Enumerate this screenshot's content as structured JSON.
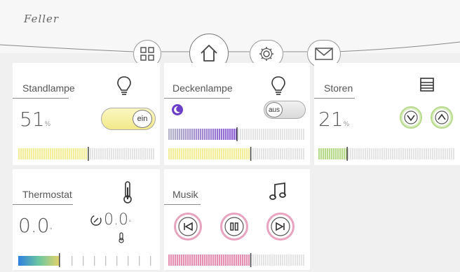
{
  "app": {
    "brand": "Feller",
    "nav": [
      {
        "icon": "grid-icon",
        "label": ""
      },
      {
        "icon": "home-icon",
        "label": ""
      },
      {
        "icon": "gear-icon",
        "label": ""
      },
      {
        "icon": "mail-icon",
        "label": ""
      }
    ]
  },
  "cards": {
    "standlampe": {
      "title": "Standlampe",
      "value": "51",
      "unit": "%",
      "toggle_label": "ein",
      "toggle_state": "on",
      "level": 0.51,
      "icon": "lightbulb-icon"
    },
    "deckenlampe": {
      "title": "Deckenlampe",
      "toggle_label": "aus",
      "toggle_state": "off",
      "mode_icon": "moon-icon",
      "color_level": 0.5,
      "level": 0.6,
      "icon": "lightbulb-icon"
    },
    "storen": {
      "title": "Storen",
      "value": "21",
      "unit": "%",
      "level": 0.21,
      "icon": "blinds-icon",
      "down_icon": "chevron-down-icon",
      "up_icon": "chevron-up-icon"
    },
    "thermostat": {
      "title": "Thermostat",
      "value": "0.0",
      "unit": "°",
      "setpoint": "0.0",
      "setpoint_unit": "°",
      "icon": "thermometer-icon",
      "setpoint_icon": "rotate-icon",
      "level": 0.3
    },
    "musik": {
      "title": "Musik",
      "icon": "music-note-icon",
      "prev_icon": "previous-icon",
      "pause_icon": "pause-icon",
      "next_icon": "next-icon",
      "level": 0.6
    }
  },
  "colors": {
    "accent_yellow": "#f4ee9a",
    "accent_pink": "#e58fb0",
    "accent_green": "#b6d98a",
    "accent_purple": "#8a5bd6",
    "line": "#888888"
  }
}
